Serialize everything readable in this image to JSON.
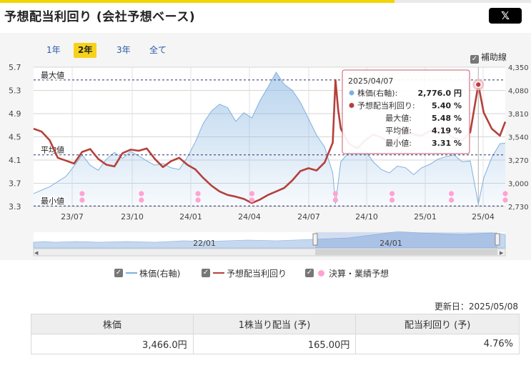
{
  "title": "予想配当利回り (会社予想ベース)",
  "share_button": "𝕏",
  "periods": [
    {
      "label": "1年",
      "active": false
    },
    {
      "label": "2年",
      "active": true
    },
    {
      "label": "3年",
      "active": false
    },
    {
      "label": "全て",
      "active": false
    }
  ],
  "aux_lines_label": "補助線",
  "chart_data": {
    "type": "line",
    "x_ticks": [
      "23/07",
      "23/10",
      "24/01",
      "24/04",
      "24/07",
      "24/10",
      "25/01",
      "25/04"
    ],
    "y_left_ticks": [
      "5.7",
      "5.3",
      "4.9",
      "4.5",
      "4.1",
      "3.7",
      "3.3"
    ],
    "y_right_ticks": [
      "4,350",
      "4,080",
      "3,810",
      "3,540",
      "3,270",
      "3,000",
      "2,730"
    ],
    "ylim_left": [
      3.3,
      5.7
    ],
    "ylim_right": [
      2730,
      4350
    ],
    "reference_lines": [
      {
        "label": "最大値",
        "value": 5.48
      },
      {
        "label": "平均値",
        "value": 4.19
      },
      {
        "label": "最小値",
        "value": 3.31
      }
    ],
    "series": [
      {
        "name": "株価(右軸)",
        "axis": "right",
        "color": "#7fb0df",
        "style": "area",
        "points": [
          [
            0,
            2880
          ],
          [
            3,
            2920
          ],
          [
            6,
            2960
          ],
          [
            9,
            3020
          ],
          [
            12,
            3080
          ],
          [
            15,
            3200
          ],
          [
            18,
            3330
          ],
          [
            21,
            3210
          ],
          [
            24,
            3150
          ],
          [
            27,
            3280
          ],
          [
            30,
            3360
          ],
          [
            33,
            3290
          ],
          [
            36,
            3370
          ],
          [
            39,
            3320
          ],
          [
            42,
            3260
          ],
          [
            45,
            3210
          ],
          [
            48,
            3230
          ],
          [
            51,
            3180
          ],
          [
            54,
            3160
          ],
          [
            57,
            3300
          ],
          [
            60,
            3480
          ],
          [
            63,
            3700
          ],
          [
            66,
            3840
          ],
          [
            69,
            3920
          ],
          [
            72,
            3880
          ],
          [
            75,
            3720
          ],
          [
            78,
            3820
          ],
          [
            81,
            3760
          ],
          [
            84,
            3960
          ],
          [
            87,
            4120
          ],
          [
            90,
            4290
          ],
          [
            93,
            4150
          ],
          [
            96,
            4080
          ],
          [
            99,
            3940
          ],
          [
            102,
            3750
          ],
          [
            105,
            3560
          ],
          [
            108,
            3420
          ],
          [
            111,
            3120
          ],
          [
            112,
            2760
          ],
          [
            114,
            3250
          ],
          [
            117,
            3360
          ],
          [
            120,
            3440
          ],
          [
            123,
            3380
          ],
          [
            126,
            3250
          ],
          [
            129,
            3160
          ],
          [
            132,
            3120
          ],
          [
            135,
            3200
          ],
          [
            138,
            3180
          ],
          [
            141,
            3100
          ],
          [
            144,
            3180
          ],
          [
            147,
            3220
          ],
          [
            150,
            3280
          ],
          [
            153,
            3310
          ],
          [
            156,
            3330
          ],
          [
            159,
            3250
          ],
          [
            162,
            3260
          ],
          [
            165,
            2760
          ],
          [
            167,
            3060
          ],
          [
            170,
            3300
          ],
          [
            173,
            3460
          ],
          [
            175,
            3466
          ]
        ]
      },
      {
        "name": "予想配当利回り",
        "axis": "left",
        "color": "#b5403a",
        "style": "line",
        "points": [
          [
            0,
            4.64
          ],
          [
            3,
            4.59
          ],
          [
            6,
            4.44
          ],
          [
            9,
            4.14
          ],
          [
            12,
            4.09
          ],
          [
            15,
            4.04
          ],
          [
            18,
            4.24
          ],
          [
            21,
            4.29
          ],
          [
            24,
            4.12
          ],
          [
            27,
            4.02
          ],
          [
            30,
            3.99
          ],
          [
            33,
            4.22
          ],
          [
            36,
            4.28
          ],
          [
            39,
            4.26
          ],
          [
            42,
            4.3
          ],
          [
            45,
            4.12
          ],
          [
            48,
            3.98
          ],
          [
            51,
            4.08
          ],
          [
            54,
            4.14
          ],
          [
            57,
            4.02
          ],
          [
            60,
            3.94
          ],
          [
            63,
            3.79
          ],
          [
            66,
            3.66
          ],
          [
            69,
            3.56
          ],
          [
            72,
            3.5
          ],
          [
            75,
            3.47
          ],
          [
            78,
            3.43
          ],
          [
            81,
            3.36
          ],
          [
            84,
            3.42
          ],
          [
            87,
            3.5
          ],
          [
            90,
            3.56
          ],
          [
            93,
            3.62
          ],
          [
            96,
            3.75
          ],
          [
            99,
            3.91
          ],
          [
            102,
            3.96
          ],
          [
            105,
            3.92
          ],
          [
            108,
            4.06
          ],
          [
            111,
            4.4
          ],
          [
            112,
            5.48
          ],
          [
            113,
            4.96
          ],
          [
            114,
            4.64
          ],
          [
            117,
            4.38
          ],
          [
            120,
            4.3
          ],
          [
            123,
            4.44
          ],
          [
            126,
            4.54
          ],
          [
            129,
            4.49
          ],
          [
            132,
            4.4
          ],
          [
            135,
            4.46
          ],
          [
            138,
            4.64
          ],
          [
            141,
            4.54
          ],
          [
            144,
            4.52
          ],
          [
            147,
            4.6
          ],
          [
            150,
            4.64
          ],
          [
            153,
            4.58
          ],
          [
            156,
            4.48
          ],
          [
            159,
            4.44
          ],
          [
            162,
            4.58
          ],
          [
            165,
            5.4
          ],
          [
            167,
            4.92
          ],
          [
            170,
            4.64
          ],
          [
            173,
            4.52
          ],
          [
            175,
            4.76
          ]
        ]
      },
      {
        "name": "決算・業績予想",
        "axis": "none",
        "color": "#ffa3d2",
        "style": "markers",
        "positions": [
          18,
          40,
          61,
          81,
          112,
          133,
          155,
          175
        ]
      }
    ],
    "navigator_ticks": [
      "22/01",
      "24/01"
    ],
    "tooltip": {
      "date": "2025/04/07",
      "rows": [
        {
          "label": "株価(右軸):",
          "value": "2,776.0 円",
          "color": "#7fb0df"
        },
        {
          "label": "予想配当利回り:",
          "value": "5.40 %",
          "color": "#b5403a"
        },
        {
          "label": "最大値:",
          "value": "5.48 %",
          "color": ""
        },
        {
          "label": "平均値:",
          "value": "4.19 %",
          "color": ""
        },
        {
          "label": "最小値:",
          "value": "3.31 %",
          "color": ""
        }
      ]
    }
  },
  "legend": [
    {
      "label": "株価(右軸)",
      "color": "#7fb0df",
      "kind": "line"
    },
    {
      "label": "予想配当利回り",
      "color": "#b5403a",
      "kind": "line"
    },
    {
      "label": "決算・業績予想",
      "color": "#ffa3d2",
      "kind": "dot"
    }
  ],
  "updated": "更新日：2025/05/08",
  "summary_table": {
    "headers": [
      "株価",
      "1株当り配当 (予)",
      "配当利回り (予)"
    ],
    "values": [
      "3,466.0円",
      "165.00円",
      "4.76%"
    ]
  }
}
